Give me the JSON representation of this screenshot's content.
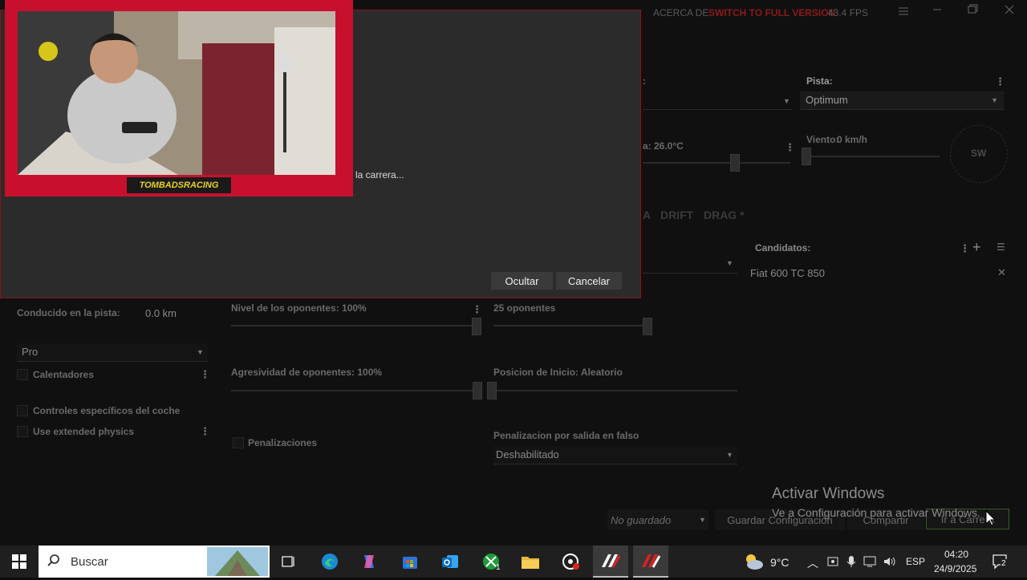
{
  "titlebar": {
    "about": "ACERCA DE",
    "full_version": "SWITCH TO FULL VERSION",
    "fps": "43.4 FPS"
  },
  "track": {
    "label": "Pista:",
    "value": "Optimum"
  },
  "weather": {
    "temp_label": "a: 26.0°C",
    "wind_label": "Viento:",
    "wind_value": "0 km/h",
    "compass": "SW"
  },
  "modes": {
    "a": "A",
    "drift": "DRIFT",
    "drag": "DRAG *"
  },
  "candidates": {
    "label": "Candidatos:",
    "car": "Fiat 600 TC 850"
  },
  "left_panel": {
    "driven_label": "Conducido en la pista:",
    "driven_value": "0.0 km",
    "level_select": "Pro",
    "warmers": "Calentadores",
    "car_controls": "Controles específicos del coche",
    "extended_physics": "Use extended physics"
  },
  "opponents": {
    "level": "Nivel de los oponentes: 100%",
    "count": "25 oponentes",
    "aggression": "Agresividad de oponentes: 100%",
    "start_position": "Posicion de Inicio: Aleatorio",
    "penalties": "Penalizaciones",
    "false_start_label": "Penalizacion por salida en falso",
    "false_start_value": "Deshabilitado"
  },
  "bottom_bar": {
    "preset": "No guardado",
    "save": "Guardar Configuración",
    "share": "Compartir",
    "go": "Ir a Carrera"
  },
  "dialog": {
    "message": "la carrera...",
    "hide": "Ocultar",
    "cancel": "Cancelar"
  },
  "webcam": {
    "overlay_name": "TOMBADSRACING"
  },
  "watermark": {
    "title": "Activar Windows",
    "subtitle": "Ve a Configuración para activar Windows."
  },
  "taskbar": {
    "search_placeholder": "Buscar",
    "weather_temp": "9°C",
    "language": "ESP",
    "time": "04:20",
    "date": "24/9/2025",
    "notification_count": "2",
    "xbox_badge": "1"
  },
  "colors": {
    "accent_red": "#c8102e",
    "background": "#101010",
    "dialog": "#2b2b2b",
    "taskbar": "#1f1f1f"
  }
}
